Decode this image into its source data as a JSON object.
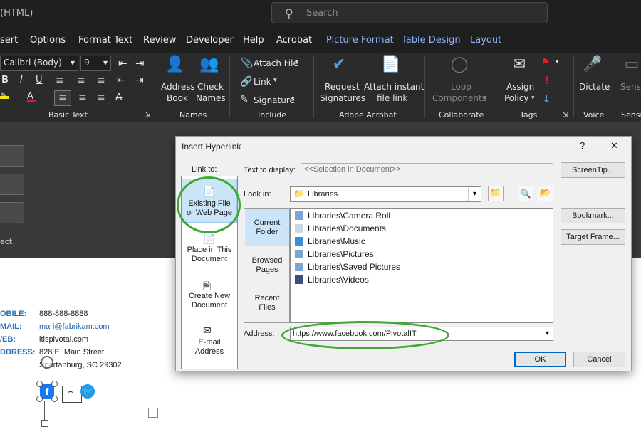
{
  "titlebar": {
    "title": "(HTML)",
    "search_placeholder": "Search"
  },
  "menu": {
    "items": [
      "sert",
      "Options",
      "Format Text",
      "Review",
      "Developer",
      "Help",
      "Acrobat"
    ],
    "context_items": [
      "Picture Format",
      "Table Design",
      "Layout"
    ]
  },
  "ribbon": {
    "font_name": "Calibri (Body)",
    "font_size": "9",
    "groups": {
      "basic_text": "Basic Text",
      "names": "Names",
      "include": "Include",
      "adobe_acrobat": "Adobe Acrobat",
      "collaborate": "Collaborate",
      "tags": "Tags",
      "voice": "Voice",
      "sensitivity": "Sensi"
    },
    "buttons": {
      "address_book": [
        "Address",
        "Book"
      ],
      "check_names": [
        "Check",
        "Names"
      ],
      "attach_file": "Attach File",
      "link": "Link",
      "signature": "Signature",
      "request_signatures": [
        "Request",
        "Signatures"
      ],
      "attach_instant": [
        "Attach instant",
        "file link"
      ],
      "loop_components": [
        "Loop",
        "Components"
      ],
      "assign_policy": [
        "Assign",
        "Policy"
      ],
      "dictate": "Dictate",
      "sensitivity": "Sensit"
    }
  },
  "left_panel": {
    "buttons": [
      "",
      "",
      ""
    ],
    "label": "ect"
  },
  "signature": {
    "rows": [
      {
        "label": "OBILE:",
        "value": "888-888-8888"
      },
      {
        "label": "MAIL:",
        "value": "mari@fabrikam.com"
      },
      {
        "label": "/EB:",
        "value": "itispivotal.com"
      },
      {
        "label": "DDRESS:",
        "value": "828 E. Main Street"
      },
      {
        "label": "",
        "value": "Spartanburg, SC 29302"
      }
    ]
  },
  "dialog": {
    "title": "Insert Hyperlink",
    "help": "?",
    "close": "✕",
    "link_to_label": "Link to:",
    "link_to_items": [
      {
        "label": [
          "Existing File",
          "or Web Page"
        ]
      },
      {
        "label": [
          "Place in This",
          "Document"
        ]
      },
      {
        "label": [
          "Create New",
          "Document"
        ]
      },
      {
        "label": [
          "E-mail",
          "Address"
        ]
      }
    ],
    "text_to_display_label": "Text to display:",
    "text_to_display_value": "<<Selection in Document>>",
    "screentip": "ScreenTip...",
    "look_in_label": "Look in:",
    "look_in_value": "Libraries",
    "nav_tabs": [
      {
        "label": [
          "Current",
          "Folder"
        ]
      },
      {
        "label": [
          "Browsed",
          "Pages"
        ]
      },
      {
        "label": [
          "Recent",
          "Files"
        ]
      }
    ],
    "files": [
      "Libraries\\Camera Roll",
      "Libraries\\Documents",
      "Libraries\\Music",
      "Libraries\\Pictures",
      "Libraries\\Saved Pictures",
      "Libraries\\Videos"
    ],
    "bookmark": "Bookmark...",
    "target_frame": "Target Frame...",
    "address_label": "Address:",
    "address_value": "https://www.facebook.com/PivotalIT",
    "ok": "OK",
    "cancel": "Cancel"
  },
  "colors": {
    "highlight": "#3ea832",
    "accent": "#2e75b6",
    "context_tab": "#8ab4f8"
  }
}
